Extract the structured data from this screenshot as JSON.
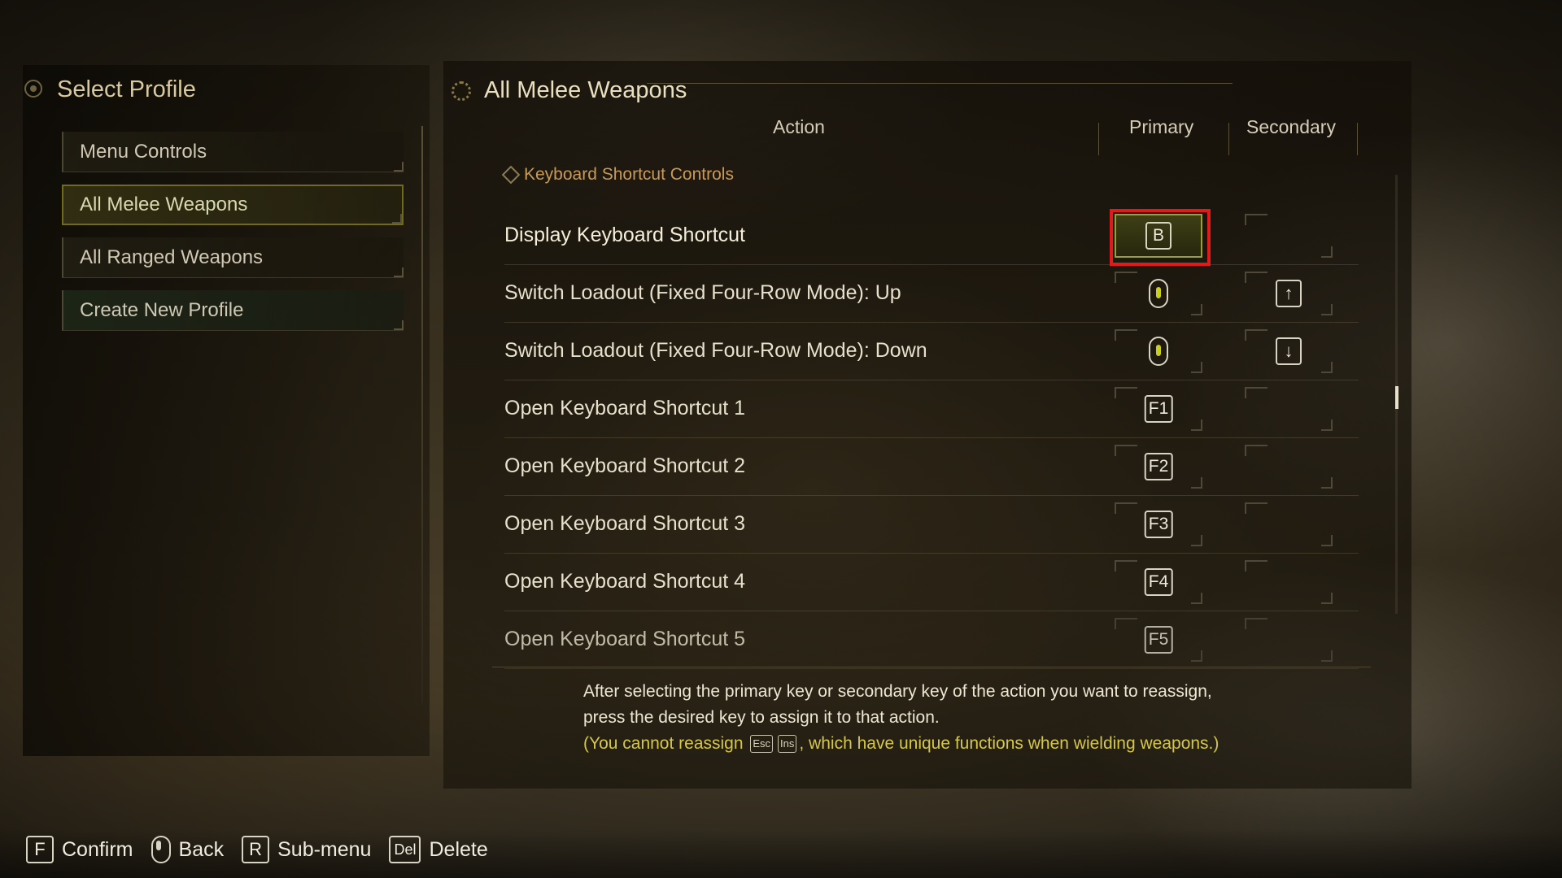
{
  "left": {
    "title": "Select Profile",
    "profiles": [
      {
        "label": "Menu Controls",
        "selected": false
      },
      {
        "label": "All Melee Weapons",
        "selected": true
      },
      {
        "label": "All Ranged Weapons",
        "selected": false
      },
      {
        "label": "Create New Profile",
        "selected": false
      }
    ]
  },
  "main": {
    "title": "All Melee Weapons",
    "columns": {
      "action": "Action",
      "primary": "Primary",
      "secondary": "Secondary"
    },
    "section": "Keyboard Shortcut Controls",
    "rows": [
      {
        "label": "Display Keyboard Shortcut",
        "primary": "B",
        "secondary": ""
      },
      {
        "label": "Switch Loadout (Fixed Four-Row Mode): Up",
        "primary_icon": "mouse-wheel-up-icon",
        "secondary": "↑"
      },
      {
        "label": "Switch Loadout (Fixed Four-Row Mode): Down",
        "primary_icon": "mouse-wheel-down-icon",
        "secondary": "↓"
      },
      {
        "label": "Open Keyboard Shortcut 1",
        "primary": "F1",
        "secondary": ""
      },
      {
        "label": "Open Keyboard Shortcut 2",
        "primary": "F2",
        "secondary": ""
      },
      {
        "label": "Open Keyboard Shortcut 3",
        "primary": "F3",
        "secondary": ""
      },
      {
        "label": "Open Keyboard Shortcut 4",
        "primary": "F4",
        "secondary": ""
      },
      {
        "label": "Open Keyboard Shortcut 5",
        "primary": "F5",
        "secondary": ""
      }
    ],
    "help": {
      "line1": "After selecting the primary key or secondary key of the action you want to reassign,",
      "line2": "press the desired key to assign it to that action.",
      "note_prefix": "(You cannot reassign",
      "key_esc": "Esc",
      "key_ins": "Ins",
      "note_suffix": ", which have unique functions when wielding weapons.)"
    }
  },
  "footer": {
    "confirm_key": "F",
    "confirm_label": "Confirm",
    "back_label": "Back",
    "submenu_key": "R",
    "submenu_label": "Sub-menu",
    "delete_key": "Del",
    "delete_label": "Delete"
  },
  "colors": {
    "focus": "#e21a1a",
    "active_slot": "#9ca12c",
    "section": "#c99a55",
    "note": "#d6c845"
  }
}
